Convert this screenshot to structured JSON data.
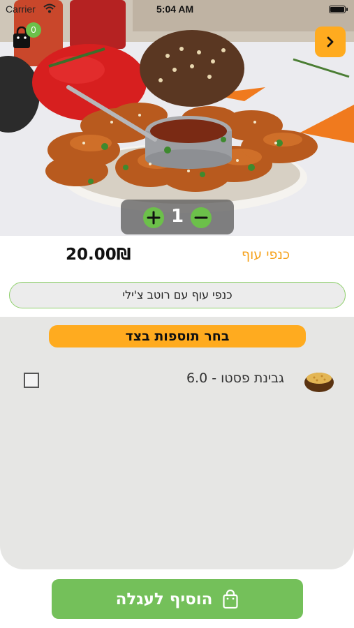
{
  "status_bar": {
    "carrier": "Carrier",
    "time": "5:04 AM"
  },
  "header": {
    "cart_count": "0"
  },
  "product": {
    "quantity": "1",
    "price": "20.00₪",
    "name": "כנפי עוף",
    "description": "כנפי עוף עם רוטב צ'ילי"
  },
  "addons": {
    "title": "בחר תוספות בצד",
    "items": [
      {
        "label": "גבינת פסטו - 6.0",
        "checked": false
      }
    ]
  },
  "footer": {
    "add_to_cart_label": "הוסיף לעגלה"
  },
  "colors": {
    "accent_orange": "#ffab1f",
    "accent_green": "#6cc04a",
    "button_green": "#74c05a",
    "name_orange": "#f6a21b"
  },
  "icons": {
    "cart": "shopping-bag-icon",
    "back": "chevron-right-icon",
    "plus": "plus-icon",
    "minus": "minus-icon",
    "addon_image": "pesto-cheese-bowl-image"
  }
}
